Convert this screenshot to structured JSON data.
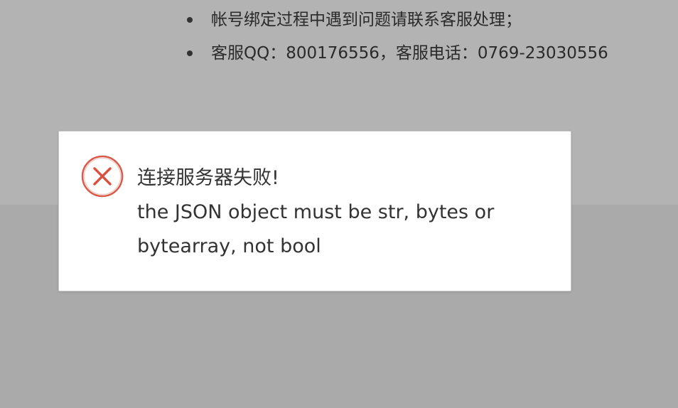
{
  "notice": {
    "items": [
      "帐号绑定过程中遇到问题请联系客服处理；",
      "客服QQ：800176556，客服电话：0769-23030556"
    ]
  },
  "dialog": {
    "icon": "error-circle-x-icon",
    "title": "连接服务器失败!",
    "detail": "the JSON object must be str, bytes or bytearray, not bool"
  },
  "colors": {
    "overlay_top": "#b3b3b3",
    "overlay_bottom": "#aaaaaa",
    "dialog_background": "#ffffff",
    "error_accent": "#d9503f",
    "text": "#333333"
  }
}
